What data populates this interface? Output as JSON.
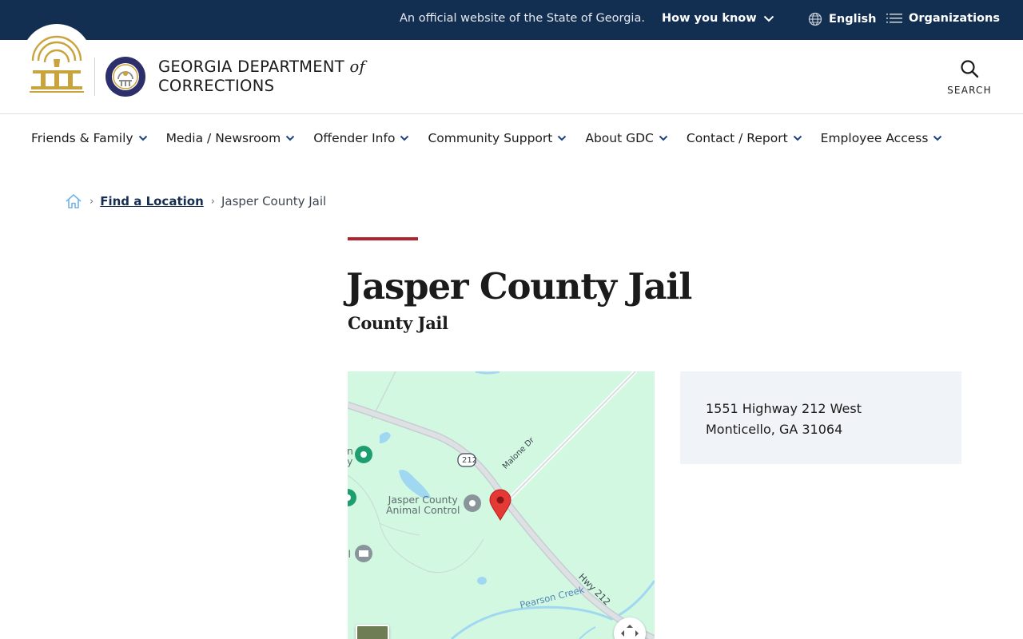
{
  "banner": {
    "official_text": "An official website of the State of Georgia.",
    "how_you_know": "How you know",
    "language": "English",
    "organizations": "Organizations"
  },
  "header": {
    "dept_line1_main": "GEORGIA DEPARTMENT",
    "dept_line1_of": "of",
    "dept_line2": "CORRECTIONS",
    "search_label": "SEARCH"
  },
  "nav": [
    {
      "label": "Friends & Family"
    },
    {
      "label": "Media / Newsroom"
    },
    {
      "label": "Offender Info"
    },
    {
      "label": "Community Support"
    },
    {
      "label": "About GDC"
    },
    {
      "label": "Contact / Report"
    },
    {
      "label": "Employee Access"
    }
  ],
  "breadcrumb": {
    "parent": "Find a Location",
    "current": "Jasper County Jail"
  },
  "page": {
    "title": "Jasper County Jail",
    "subtitle": "County Jail"
  },
  "map": {
    "poi_label_line1": "Jasper County",
    "poi_label_line2": "Animal Control",
    "road_212": "212",
    "malone_dr": "Malone Dr",
    "hwy_212": "Hwy 212",
    "pearson_creek": "Pearson Creek",
    "edge_label_1": "n",
    "edge_label_2": "y",
    "edge_label_3": "ll"
  },
  "address": {
    "line1": "1551 Highway 212 West",
    "line2": "Monticello, GA 31064"
  },
  "colors": {
    "banner_bg": "#122e51",
    "accent_red": "#b1232e",
    "map_green": "#d3f8e2",
    "pin_red": "#e53935",
    "seal_gold": "#c9a43c"
  }
}
